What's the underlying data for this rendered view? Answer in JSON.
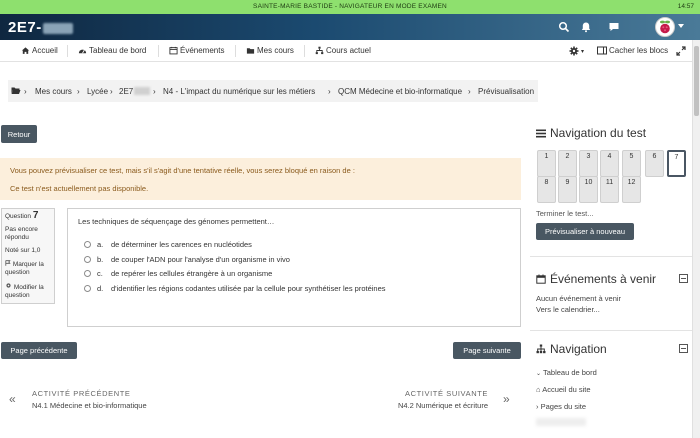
{
  "exam_bar": {
    "title": "SAINTE-MARIE BASTIDE - NAVIGATEUR EN MODE EXAMEN",
    "time": "14:57"
  },
  "navbar": {
    "brand": "2E7-"
  },
  "secondary_nav": {
    "items": [
      "Accueil",
      "Tableau de bord",
      "Événements",
      "Mes cours",
      "Cours actuel"
    ],
    "hide_blocks": "Cacher les blocs"
  },
  "breadcrumb": [
    "Mes cours",
    "Lycée",
    "2E7",
    "N4 - L'impact du numérique sur les métiers",
    "QCM Médecine et bio-informatique",
    "Prévisualisation"
  ],
  "buttons": {
    "back": "Retour",
    "prev_page": "Page précédente",
    "next_page": "Page suivante"
  },
  "alert": {
    "line1": "Vous pouvez prévisualiser ce test, mais s'il s'agit d'une tentative réelle, vous serez bloqué en raison de :",
    "line2": "Ce test n'est actuellement pas disponible."
  },
  "question_info": {
    "label": "Question",
    "number": "7",
    "status": "Pas encore répondu",
    "grade": "Noté sur 1,0",
    "flag": "Marquer la question",
    "edit": "Modifier la question"
  },
  "question": {
    "text": "Les techniques de séquençage des génomes permettent…",
    "options": [
      {
        "letter": "a.",
        "text": "de déterminer les carences en nucléotides"
      },
      {
        "letter": "b.",
        "text": "de couper l'ADN pour l'analyse d'un organisme in vivo"
      },
      {
        "letter": "c.",
        "text": "de repérer les cellules étrangère à un organisme"
      },
      {
        "letter": "d.",
        "text": "d'identifier les régions codantes utilisée par la cellule pour synthétiser les protéines"
      }
    ]
  },
  "activity_nav": {
    "prev_heading": "ACTIVITÉ PRÉCÉDENTE",
    "prev_name": "N4.1 Médecine et bio-informatique",
    "next_heading": "ACTIVITÉ SUIVANTE",
    "next_name": "N4.2 Numérique et écriture"
  },
  "quiz_nav": {
    "title": "Navigation du test",
    "cells": [
      "1",
      "2",
      "3",
      "4",
      "5",
      "6",
      "7",
      "8",
      "9",
      "10",
      "11",
      "12"
    ],
    "current": "7",
    "finish": "Terminer le test...",
    "restart": "Prévisualiser à nouveau"
  },
  "events": {
    "title": "Événements à venir",
    "none": "Aucun événement à venir",
    "calendar": "Vers le calendrier..."
  },
  "navigation": {
    "title": "Navigation",
    "items": [
      "Tableau de bord",
      "Accueil du site",
      "Pages du site"
    ]
  },
  "colors": {
    "exam_bar": "#8ee06e",
    "navbar": "#1b4a70",
    "button": "#495762",
    "alert_bg": "#fcefdc",
    "alert_text": "#8a5a1c"
  }
}
